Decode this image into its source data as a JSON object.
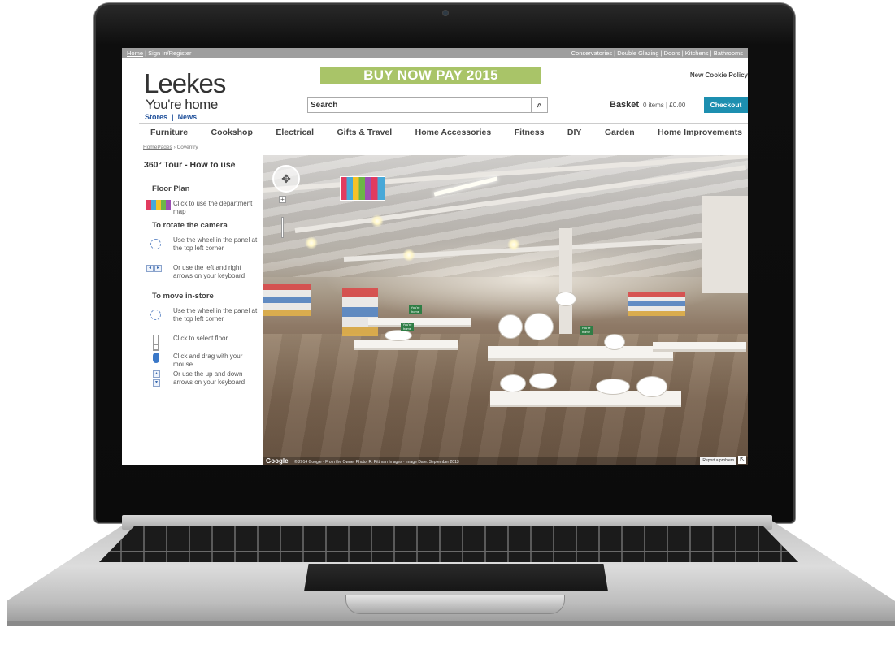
{
  "topbar": {
    "left": [
      "Home",
      "Sign In/Register"
    ],
    "right": [
      "Conservatories",
      "Double Glazing",
      "Doors",
      "Kitchens",
      "Bathrooms"
    ]
  },
  "brand": {
    "name": "Leekes",
    "tagline": "You're home",
    "links": [
      "Stores",
      "News"
    ]
  },
  "promo": "BUY NOW PAY 2015",
  "cookie_link": "New Cookie Policy",
  "search": {
    "placeholder": "Search",
    "icon": "search-icon"
  },
  "basket": {
    "label": "Basket",
    "info": "0 items | £0.00",
    "checkout": "Checkout"
  },
  "nav": [
    "Furniture",
    "Cookshop",
    "Electrical",
    "Gifts & Travel",
    "Home Accessories",
    "Fitness",
    "DIY",
    "Garden",
    "Home Improvements"
  ],
  "breadcrumb": [
    "HomePages",
    "Coventry"
  ],
  "sidebar": {
    "title": "360° Tour - How to use",
    "floor_plan": {
      "heading": "Floor Plan",
      "text": "Click to use the department map"
    },
    "rotate": {
      "heading": "To rotate the camera",
      "wheel": "Use the wheel in the panel at the top left corner",
      "arrows": "Or use the left and right arrows on your keyboard"
    },
    "move": {
      "heading": "To move in-store",
      "wheel": "Use the wheel in the panel at the top left corner",
      "floor": "Click to select floor",
      "drag": "Click and drag with your mouse",
      "arrows": "Or use the up and down arrows on your keyboard"
    }
  },
  "pano": {
    "signs": [
      "You're home",
      "You're home",
      "You're home"
    ],
    "google": "Google",
    "credits": "© 2014 Google · From the Owner  Photo: R. Pittman Images · Image Date: September 2013",
    "report": "Report a problem"
  }
}
